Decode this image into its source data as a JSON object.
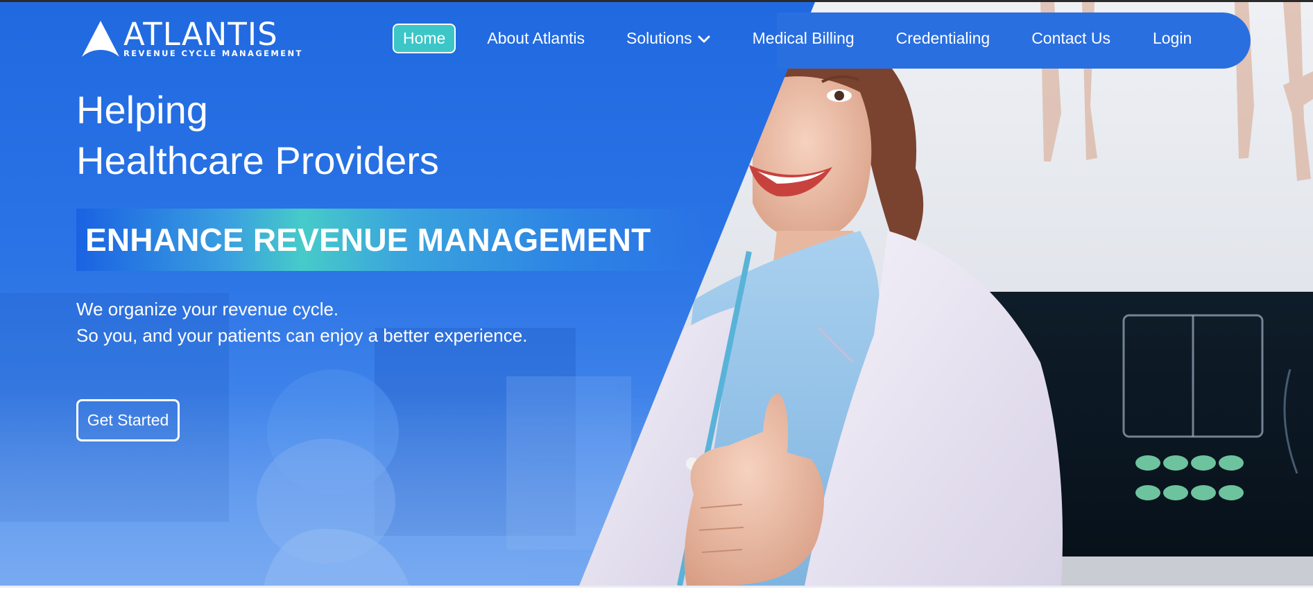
{
  "brand": {
    "name": "ATLANTIS",
    "tagline": "REVENUE CYCLE MANAGEMENT"
  },
  "nav": {
    "items": [
      {
        "label": "Home",
        "active": true
      },
      {
        "label": "About Atlantis"
      },
      {
        "label": "Solutions",
        "has_dropdown": true
      },
      {
        "label": "Medical Billing"
      },
      {
        "label": "Credentialing"
      },
      {
        "label": "Contact Us"
      },
      {
        "label": "Login"
      }
    ]
  },
  "hero": {
    "headline_line1": "Helping",
    "headline_line2": "Healthcare Providers",
    "banner": "ENHANCE REVENUE MANAGEMENT",
    "subtext_line1": "We organize your revenue cycle.",
    "subtext_line2": "So you, and your patients can enjoy a better experience.",
    "cta_label": "Get Started"
  },
  "colors": {
    "primary_blue": "#2069e0",
    "accent_teal": "#3cc6c7",
    "text_white": "#ffffff"
  },
  "icons": {
    "logo": "triangle-sail-logo",
    "dropdown": "chevron-down-icon"
  }
}
